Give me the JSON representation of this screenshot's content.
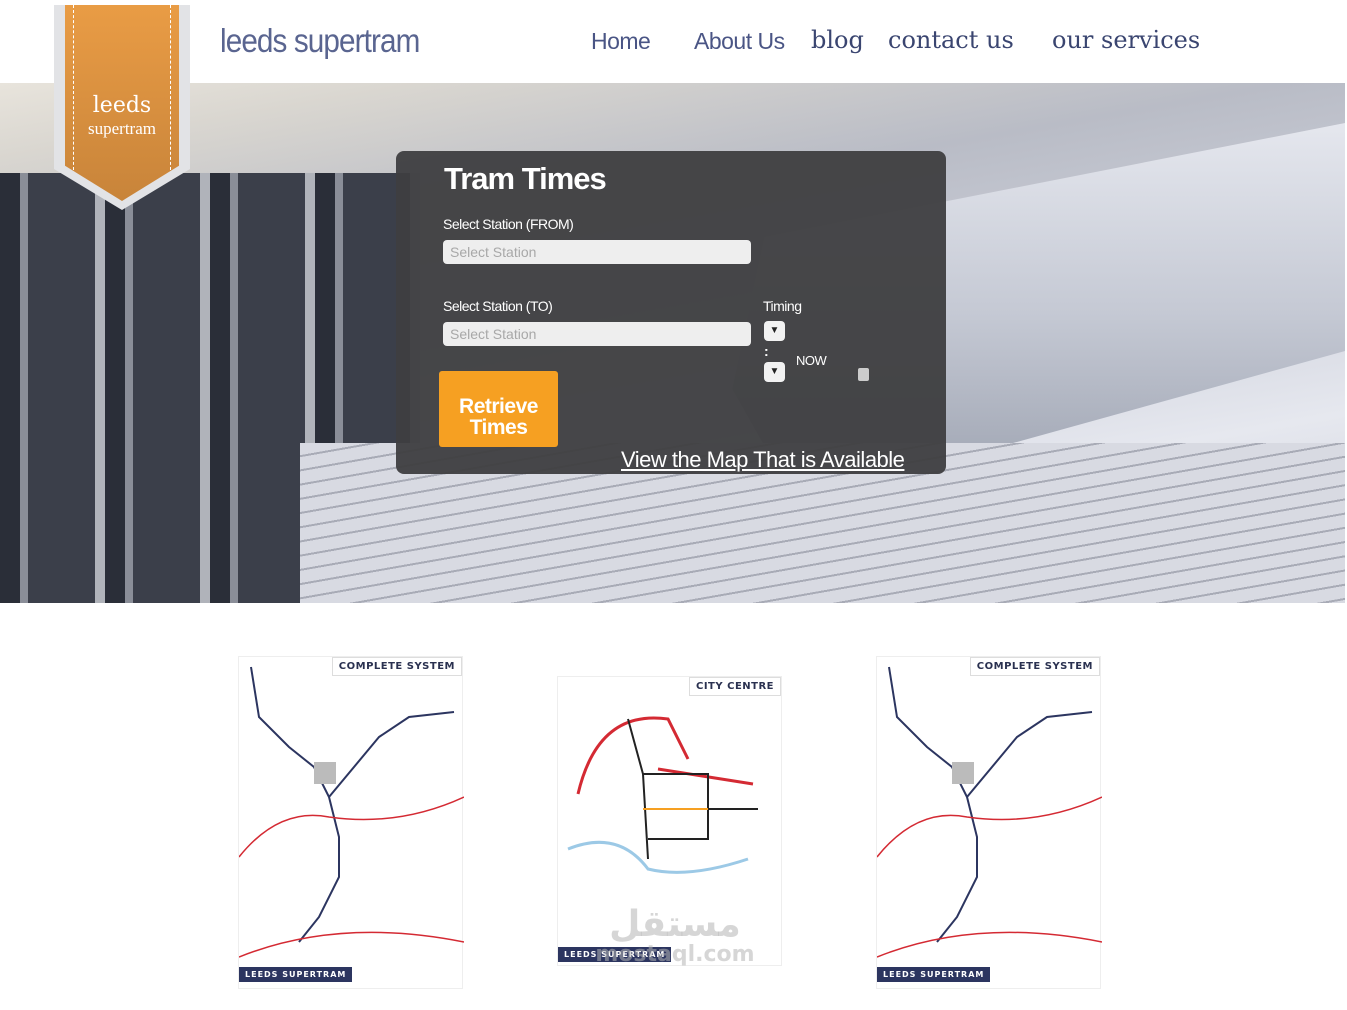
{
  "header": {
    "site_title": "leeds supertram",
    "logo_line1": "leeds",
    "logo_line2": "supertram"
  },
  "nav": [
    {
      "label": "Home"
    },
    {
      "label": "About Us"
    },
    {
      "label": "blog"
    },
    {
      "label": "contact us"
    },
    {
      "label": "our services"
    }
  ],
  "tram_times": {
    "title": "Tram Times",
    "from_label": "Select Station (FROM)",
    "from_placeholder": "Select Station",
    "to_label": "Select Station (TO)",
    "to_placeholder": "Select Station",
    "timing_label": "Timing",
    "dropdown_glyph": "▼",
    "separator": ":",
    "now_label": "NOW",
    "now_checked": false,
    "retrieve_button": "Retrieve Times",
    "map_link": "View the Map That is Available"
  },
  "maps": [
    {
      "title": "COMPLETE SYSTEM",
      "footer": "LEEDS SUPERTRAM"
    },
    {
      "title": "CITY CENTRE",
      "footer": "LEEDS SUPERTRAM"
    },
    {
      "title": "COMPLETE SYSTEM",
      "footer": "LEEDS SUPERTRAM"
    }
  ],
  "watermark": {
    "text": "mostaql.com"
  },
  "colors": {
    "accent": "#f6a022",
    "nav": "#4a5585",
    "panel": "#3e3e40",
    "line_red": "#d42a33",
    "line_dark": "#2c3560"
  }
}
